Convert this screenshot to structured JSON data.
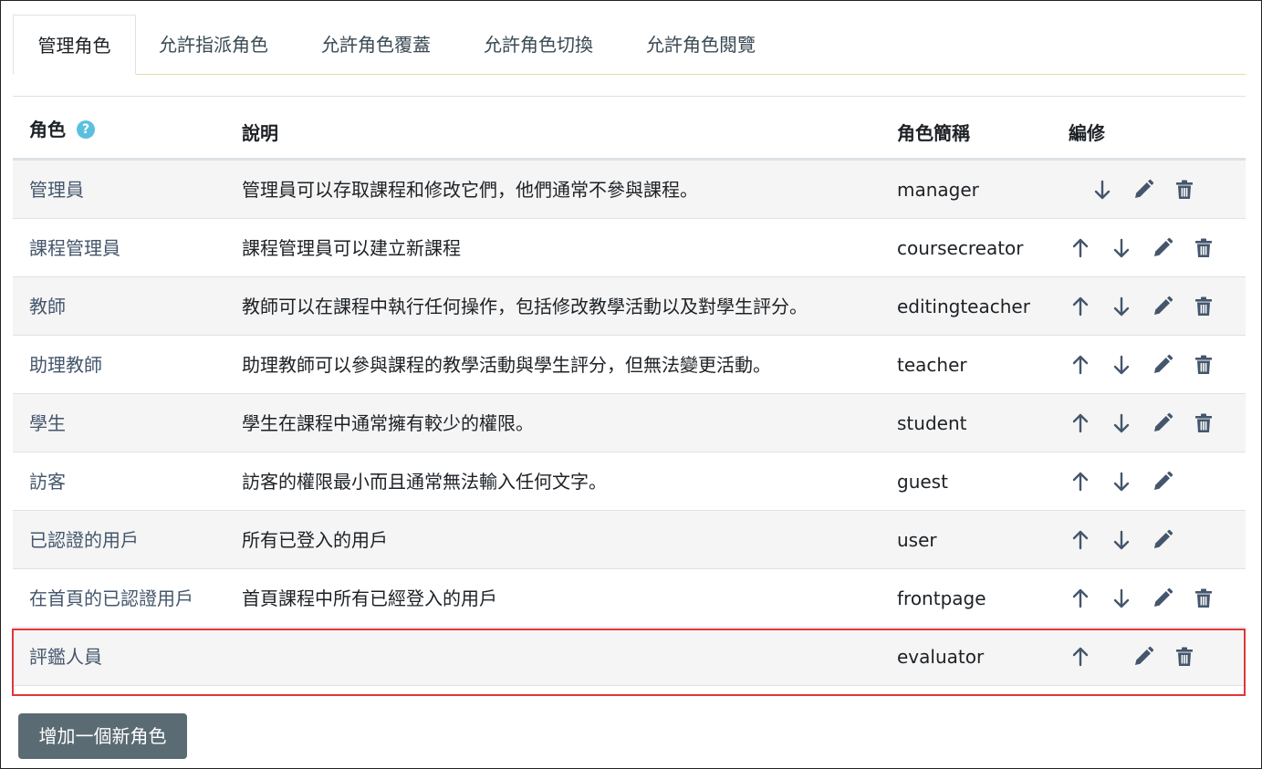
{
  "tabs": [
    {
      "label": "管理角色",
      "active": true
    },
    {
      "label": "允許指派角色",
      "active": false
    },
    {
      "label": "允許角色覆蓋",
      "active": false
    },
    {
      "label": "允許角色切換",
      "active": false
    },
    {
      "label": "允許角色閱覽",
      "active": false
    }
  ],
  "table": {
    "headers": {
      "role": "角色",
      "help_glyph": "?",
      "description": "說明",
      "shortname": "角色簡稱",
      "edit": "編修"
    },
    "rows": [
      {
        "name": "管理員",
        "description": "管理員可以存取課程和修改它們，他們通常不參與課程。",
        "shortname": "manager",
        "up": false,
        "down": true,
        "edit": true,
        "delete": true
      },
      {
        "name": "課程管理員",
        "description": "課程管理員可以建立新課程",
        "shortname": "coursecreator",
        "up": true,
        "down": true,
        "edit": true,
        "delete": true
      },
      {
        "name": "教師",
        "description": "教師可以在課程中執行任何操作，包括修改教學活動以及對學生評分。",
        "shortname": "editingteacher",
        "up": true,
        "down": true,
        "edit": true,
        "delete": true
      },
      {
        "name": "助理教師",
        "description": "助理教師可以參與課程的教學活動與學生評分，但無法變更活動。",
        "shortname": "teacher",
        "up": true,
        "down": true,
        "edit": true,
        "delete": true
      },
      {
        "name": "學生",
        "description": "學生在課程中通常擁有較少的權限。",
        "shortname": "student",
        "up": true,
        "down": true,
        "edit": true,
        "delete": true
      },
      {
        "name": "訪客",
        "description": "訪客的權限最小而且通常無法輸入任何文字。",
        "shortname": "guest",
        "up": true,
        "down": true,
        "edit": true,
        "delete": false
      },
      {
        "name": "已認證的用戶",
        "description": "所有已登入的用戶",
        "shortname": "user",
        "up": true,
        "down": true,
        "edit": true,
        "delete": false
      },
      {
        "name": "在首頁的已認證用戶",
        "description": "首頁課程中所有已經登入的用戶",
        "shortname": "frontpage",
        "up": true,
        "down": true,
        "edit": true,
        "delete": true
      },
      {
        "name": "評鑑人員",
        "description": "",
        "shortname": "evaluator",
        "up": true,
        "down": false,
        "edit": true,
        "delete": true
      }
    ]
  },
  "add_button_label": "增加一個新角色",
  "colors": {
    "icon": "#44566c",
    "link": "#44566c",
    "highlight": "#e0363a",
    "button_bg": "#5a6b73",
    "help_bg": "#5bc0de"
  },
  "icons": [
    "arrow-up-icon",
    "arrow-down-icon",
    "pencil-icon",
    "trash-icon",
    "help-icon"
  ]
}
